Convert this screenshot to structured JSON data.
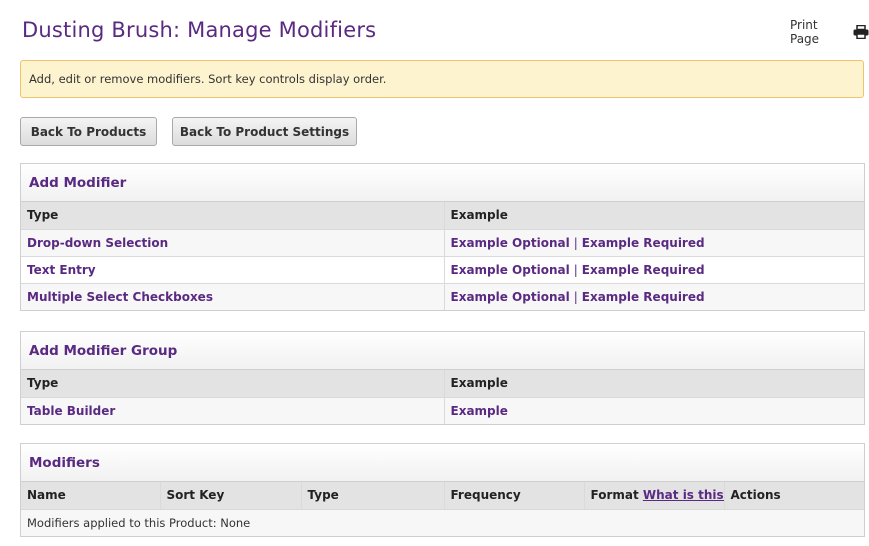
{
  "page": {
    "title": "Dusting Brush: Manage Modifiers",
    "print_label": "Print Page",
    "notice": "Add, edit or remove modifiers. Sort key controls display order."
  },
  "buttons": {
    "back_products": "Back To Products",
    "back_settings": "Back To Product Settings"
  },
  "add_modifier": {
    "heading": "Add Modifier",
    "col_type": "Type",
    "col_example": "Example",
    "rows": [
      {
        "type": "Drop-down Selection",
        "optional": "Example Optional",
        "sep": "|",
        "required": "Example Required"
      },
      {
        "type": "Text Entry",
        "optional": "Example Optional",
        "sep": "|",
        "required": "Example Required"
      },
      {
        "type": "Multiple Select Checkboxes",
        "optional": "Example Optional",
        "sep": "|",
        "required": "Example Required"
      }
    ]
  },
  "add_group": {
    "heading": "Add Modifier Group",
    "col_type": "Type",
    "col_example": "Example",
    "rows": [
      {
        "type": "Table Builder",
        "example": "Example"
      }
    ]
  },
  "modifiers": {
    "heading": "Modifiers",
    "col_name": "Name",
    "col_sort": "Sort Key",
    "col_type": "Type",
    "col_frequency": "Frequency",
    "col_format": "Format",
    "what_link": "What is this?",
    "col_actions": "Actions",
    "empty_text": "Modifiers applied to this Product: None"
  },
  "colors": {
    "brand": "#5a2a82",
    "notice_bg": "#fdf3cf",
    "notice_border": "#f0c36d"
  }
}
